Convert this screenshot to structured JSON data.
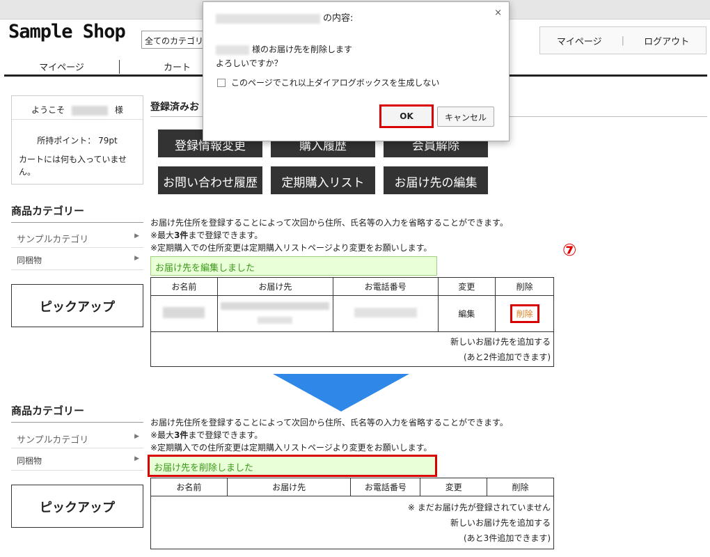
{
  "header": {
    "logo": "Sample Shop",
    "category_select": "全てのカテゴリ",
    "mypage": "マイページ",
    "logout": "ログアウト",
    "separator": "|"
  },
  "gnav": {
    "items": [
      "マイページ",
      "カート"
    ]
  },
  "sidebar": {
    "welcome_prefix": "ようこそ",
    "welcome_suffix": "様",
    "points": "所持ポイント： 79pt",
    "cart": "カートには何も入っていません。",
    "category_heading": "商品カテゴリー",
    "categories": [
      "サンプルカテゴリ",
      "同梱物"
    ],
    "pickup": "ピックアップ"
  },
  "main": {
    "section_title": "登録済みお",
    "buttons": [
      "登録情報変更",
      "購入履歴",
      "会員解除",
      "お問い合わせ履歴",
      "定期購入リスト",
      "お届け先の編集"
    ],
    "info_line1": "お届け先住所を登録することによって次回から住所、氏名等の入力を省略することができます。",
    "info_line2_pre": "※最大",
    "info_line2_bold": "3件",
    "info_line2_post": "まで登録できます。",
    "info_line3": "※定期購入での住所変更は定期購入リストページより変更をお願いします。",
    "table_headers": [
      "お名前",
      "お届け先",
      "お電話番号",
      "変更",
      "削除"
    ],
    "before": {
      "notice": "お届け先を編集しました",
      "edit": "編集",
      "delete": "削除",
      "add_new": "新しいお届け先を追加する",
      "remaining": "(あと2件追加できます)"
    },
    "after": {
      "notice": "お届け先を削除しました",
      "empty": "※ まだお届け先が登録されていません",
      "add_new": "新しいお届け先を追加する",
      "remaining": "(あと3件追加できます)"
    },
    "step_marker": "⑦"
  },
  "dialog": {
    "title_suffix": "の内容:",
    "close": "×",
    "line1_suffix": "様のお届け先を削除します",
    "line2": "よろしいですか？",
    "checkbox_label": "このページでこれ以上ダイアログボックスを生成しない",
    "ok": "OK",
    "cancel": "キャンセル"
  },
  "colors": {
    "notice_bg": "#e8ffd8",
    "notice_text": "#3c9a19",
    "highlight": "#d80000",
    "arrow": "#2f87e8",
    "button_bg": "#333333"
  }
}
